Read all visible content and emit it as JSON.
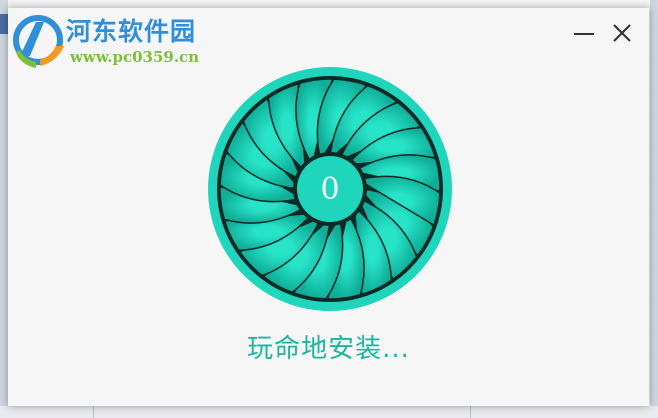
{
  "watermark": {
    "brand": "河东软件园",
    "url": "www.pc0359.cn"
  },
  "window": {
    "minimize_icon": "minimize-icon",
    "close_icon": "close-icon"
  },
  "progress": {
    "value": "0"
  },
  "status": {
    "text": "玩命地安装..."
  },
  "colors": {
    "accent": "#19b7a2",
    "ring": "#1fd6bd",
    "hub": "#1fd6bd",
    "blade": "#20cfb6",
    "fan_background": "#0b2a26"
  }
}
